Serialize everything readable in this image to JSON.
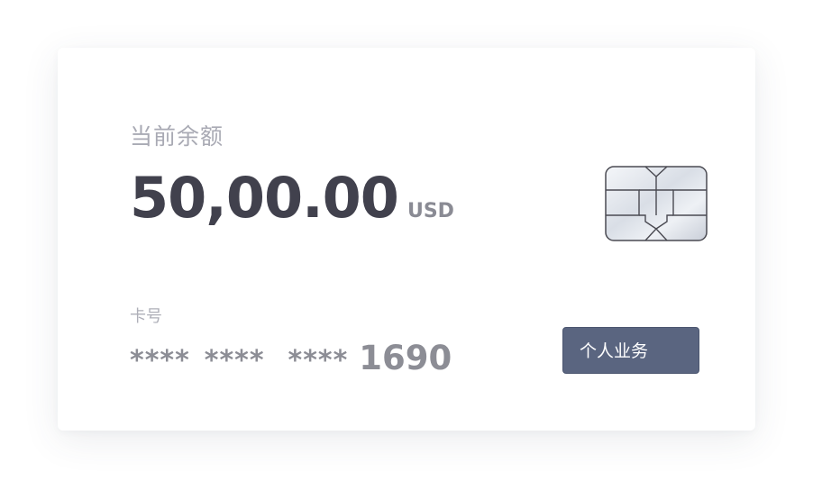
{
  "card": {
    "balance_label": "当前余额",
    "balance_amount": "50,00.00",
    "currency": "USD",
    "card_number_label": "卡号",
    "card_number_masks": [
      "****",
      "****",
      "****"
    ],
    "card_number_last4": "1690",
    "action_button_label": "个人业务",
    "chip_icon": "sim-chip-icon"
  },
  "colors": {
    "amount_text": "#41414d",
    "label_text": "#a9aab4",
    "button_bg": "#5a6580",
    "button_text": "#ffffff"
  }
}
